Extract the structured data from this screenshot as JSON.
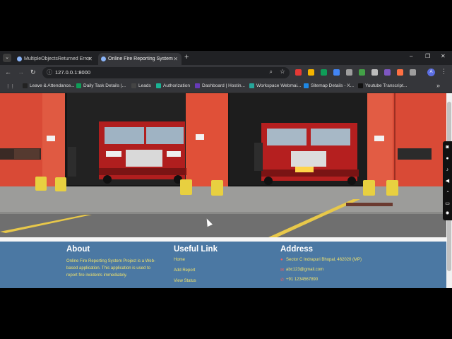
{
  "browser": {
    "tabs": [
      {
        "title": "MultipleObjectsReturned Error",
        "active": false
      },
      {
        "title": "Online Fire Reporting System",
        "active": true
      }
    ],
    "url": "127.0.0.1:8000",
    "profile_initial": "A",
    "bookmarks": [
      {
        "label": "Leave & Attendance...",
        "color": "#222222"
      },
      {
        "label": "Daily Task Details |...",
        "color": "#0f9d58"
      },
      {
        "label": "Leads",
        "color": "#444444"
      },
      {
        "label": "Authorization",
        "color": "#1ab394"
      },
      {
        "label": "Dashboard | Hostin...",
        "color": "#673ab7"
      },
      {
        "label": "Workspace Webmai...",
        "color": "#26a69a"
      },
      {
        "label": "Sitemap Details - X...",
        "color": "#1e88e5"
      },
      {
        "label": "Youtube Transcript...",
        "color": "#111111"
      }
    ]
  },
  "footer": {
    "about": {
      "heading": "About",
      "text_lines": [
        "Online Fire Reporting System Project is a Web-",
        "based application. This application is used to",
        "report fire incidents immediately."
      ]
    },
    "links": {
      "heading": "Useful Link",
      "items": [
        "Home",
        "Add Report",
        "View Status"
      ]
    },
    "address": {
      "heading": "Address",
      "location": "Sector C Indrapuri Bhopal, 462020 (MP)",
      "email": "abc123@gmail.com",
      "phone": "+91 1234567890"
    }
  },
  "colors": {
    "footer_bg": "#4b78a3",
    "footer_text": "#f2e36b",
    "icon_red": "#ff5a5a"
  }
}
